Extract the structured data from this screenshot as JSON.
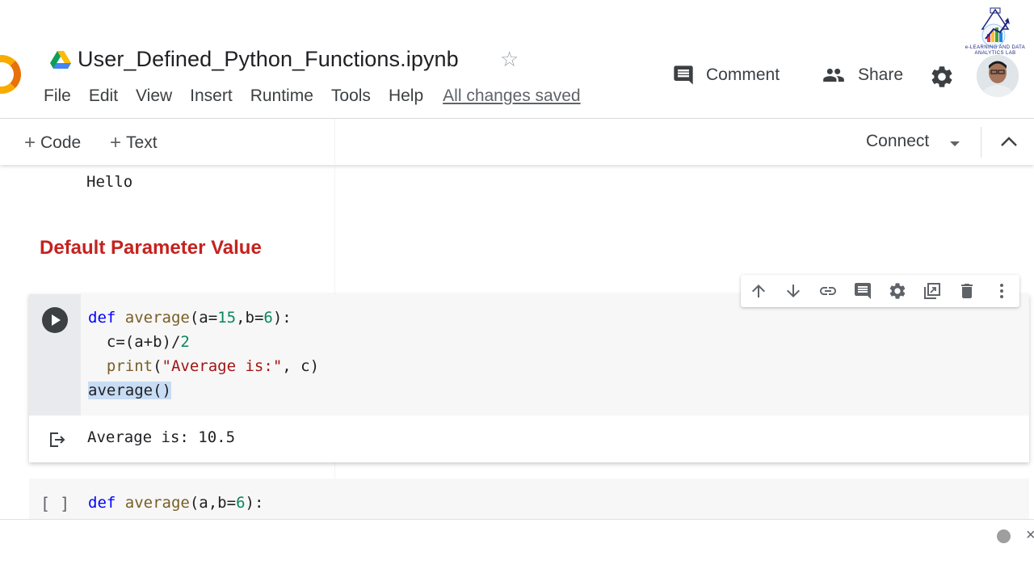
{
  "header": {
    "doc_title": "User_Defined_Python_Functions.ipynb",
    "menu": [
      "File",
      "Edit",
      "View",
      "Insert",
      "Runtime",
      "Tools",
      "Help"
    ],
    "save_status": "All changes saved",
    "comment_label": "Comment",
    "share_label": "Share",
    "lab_logo_text": "e-LEARNING AND DATA ANALYTICS LAB"
  },
  "toolbar": {
    "add_code_label": "Code",
    "add_text_label": "Text",
    "connect_label": "Connect"
  },
  "notebook": {
    "prev_output": "Hello",
    "section_heading": "Default Parameter Value",
    "cell1": {
      "output": "Average is: 10.5"
    },
    "cell2": {
      "bracket": "[ ]"
    }
  },
  "colors": {
    "heading_red": "#c5221f",
    "keyword_blue": "#0000ff",
    "number_green": "#09885a",
    "string_red": "#a31515",
    "function_brown": "#795e26",
    "accent_orange": "#f9ab00"
  },
  "icons": [
    "drive-icon",
    "star-icon",
    "comment-icon",
    "share-icon",
    "gear-icon",
    "move-up-icon",
    "move-down-icon",
    "link-icon",
    "comment-cell-icon",
    "cell-settings-icon",
    "mirror-cell-icon",
    "delete-icon",
    "more-vert-icon",
    "run-icon",
    "output-redirect-icon"
  ]
}
